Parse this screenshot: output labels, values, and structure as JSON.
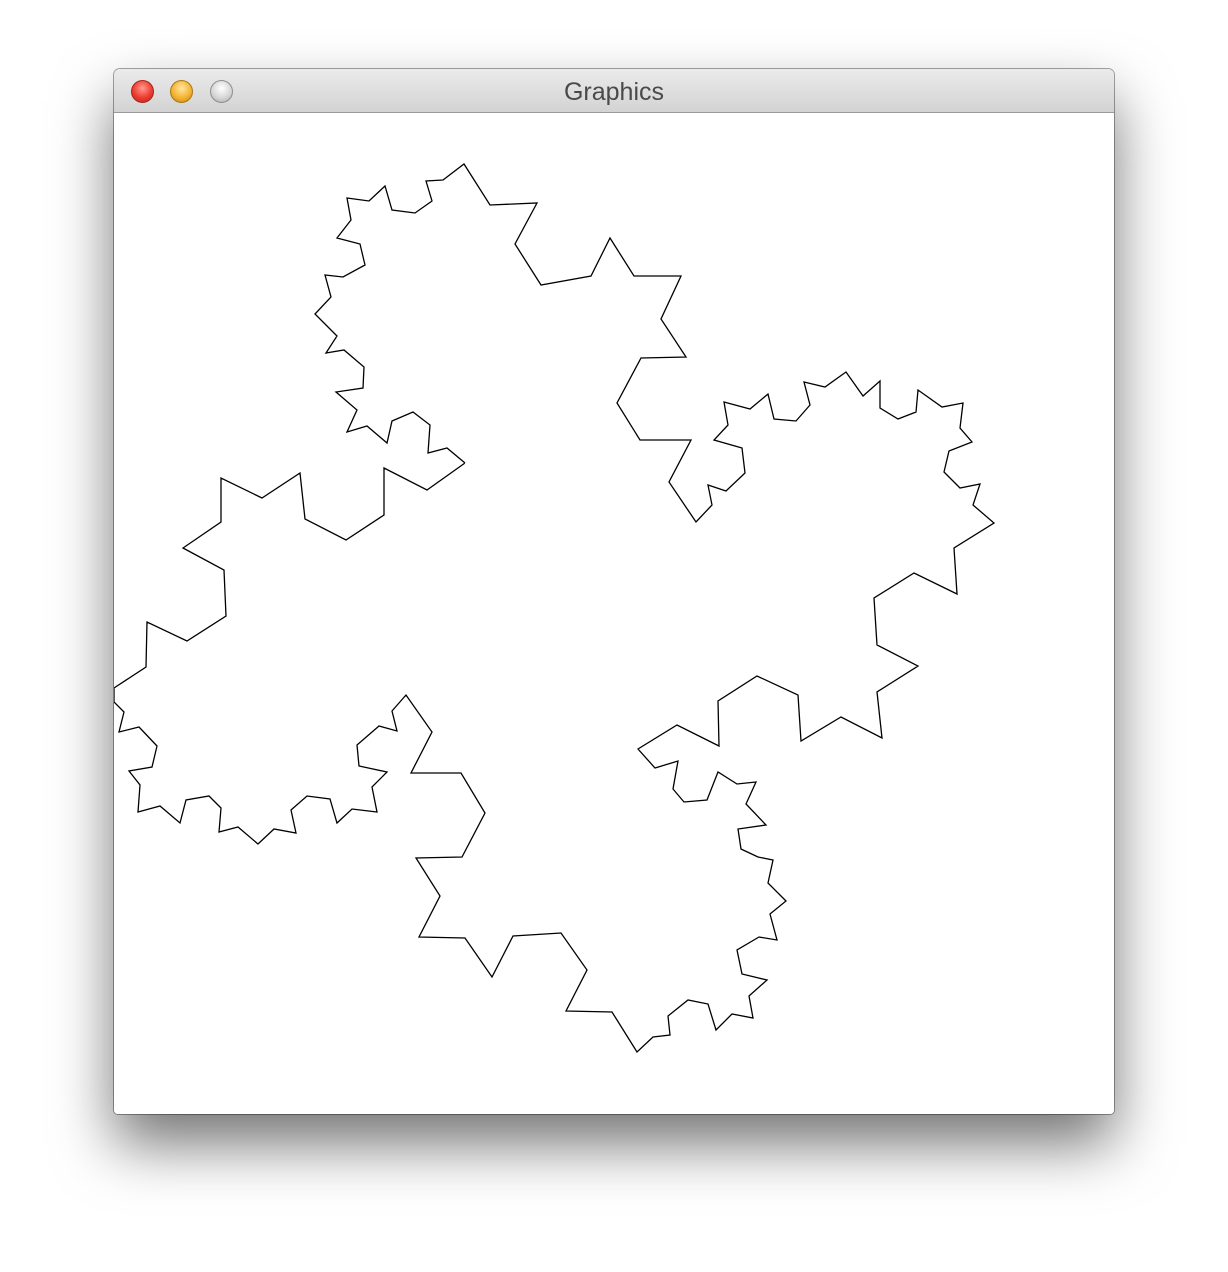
{
  "window": {
    "title": "Graphics"
  },
  "titlebar": {
    "buttons": [
      {
        "name": "close",
        "color": "#ee3b2f"
      },
      {
        "name": "minimize",
        "color": "#f5b332"
      },
      {
        "name": "zoom",
        "color": "#d7d7d7"
      }
    ]
  },
  "canvas": {
    "background": "#ffffff",
    "stroke_color": "#000000"
  }
}
